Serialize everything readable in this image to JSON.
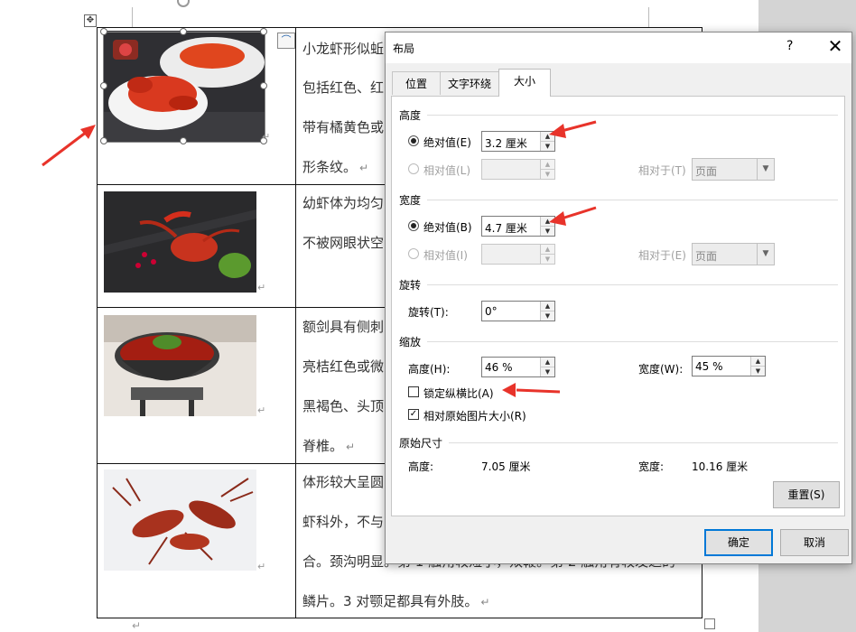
{
  "document": {
    "rows": [
      {
        "lines": [
          "小龙虾形似蚯",
          "包括红色、红",
          "带有橘黄色或",
          "形条纹。"
        ]
      },
      {
        "lines": [
          "幼虾体为均匀",
          "不被网眼状空"
        ]
      },
      {
        "lines": [
          "额剑具有侧刺",
          "亮桔红色或微",
          "黑褐色、头顶",
          "脊椎。"
        ]
      },
      {
        "lines": [
          "体形较大呈圆",
          "虾科外，不与",
          "合。颈沟明显。第 1 触角较短小，双鞭。第 2 触角有较发达的",
          "鳞片。3 对颚足都具有外肢。"
        ]
      }
    ],
    "pilcrow": "↵"
  },
  "dialog": {
    "title": "布局",
    "help": "?",
    "close": "✕",
    "tabs": [
      {
        "label": "位置"
      },
      {
        "label": "文字环绕"
      },
      {
        "label": "大小",
        "active": true
      }
    ],
    "height": {
      "section": "高度",
      "absolute_label": "绝对值(E)",
      "absolute_value": "3.2 厘米",
      "relative_label": "相对值(L)",
      "relative_value": "",
      "relative_to_label": "相对于(T)",
      "relative_to_value": "页面"
    },
    "width": {
      "section": "宽度",
      "absolute_label": "绝对值(B)",
      "absolute_value": "4.7 厘米",
      "relative_label": "相对值(I)",
      "relative_value": "",
      "relative_to_label": "相对于(E)",
      "relative_to_value": "页面"
    },
    "rotation": {
      "section": "旋转",
      "label": "旋转(T):",
      "value": "0°"
    },
    "scale": {
      "section": "缩放",
      "height_label": "高度(H):",
      "height_value": "46 %",
      "width_label": "宽度(W):",
      "width_value": "45 %",
      "lock_ratio_label": "锁定纵横比(A)",
      "lock_ratio_checked": false,
      "relative_original_label": "相对原始图片大小(R)",
      "relative_original_checked": true
    },
    "original": {
      "section": "原始尺寸",
      "height_label": "高度:",
      "height_value": "7.05 厘米",
      "width_label": "宽度:",
      "width_value": "10.16 厘米"
    },
    "reset_button": "重置(S)",
    "ok_button": "确定",
    "cancel_button": "取消"
  },
  "colors": {
    "annotation_arrow": "#e8332a",
    "primary_border": "#0078d7"
  }
}
